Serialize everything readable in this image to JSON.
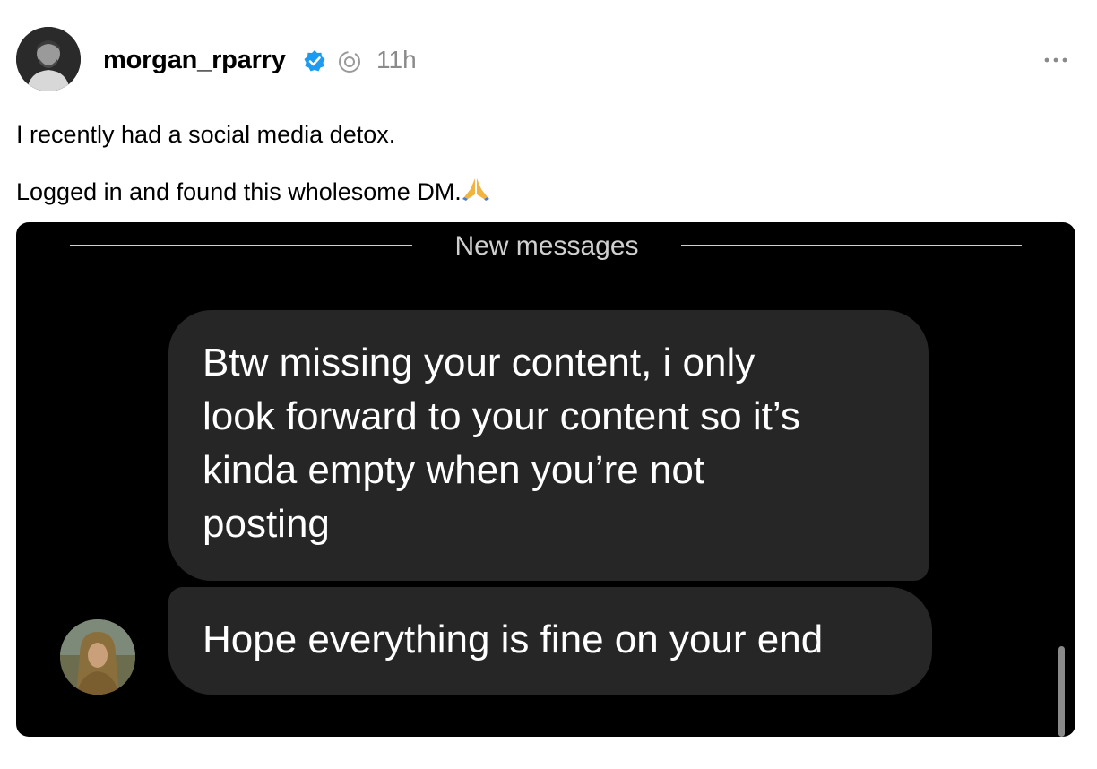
{
  "post": {
    "username": "morgan_rparry",
    "time_ago": "11h",
    "caption_line1": "I recently had a social media detox.",
    "caption_line2": "Logged in and found this wholesome DM.",
    "caption_emoji": "pray-hands-icon"
  },
  "icons": {
    "verified": "verified-badge-icon",
    "threads": "threads-logo-icon",
    "more": "more-options-icon"
  },
  "colors": {
    "verified_blue": "#1d9bf0",
    "muted_text": "#8a8a8a",
    "dm_background": "#000000",
    "bubble_background": "#262626"
  },
  "dm": {
    "divider_label": "New messages",
    "messages": [
      {
        "lines": [
          "Btw missing your content, i only",
          "look forward to your content so it’s",
          "kinda empty when you’re not",
          "posting"
        ]
      },
      {
        "lines": [
          "Hope everything is fine on your end"
        ]
      }
    ]
  }
}
